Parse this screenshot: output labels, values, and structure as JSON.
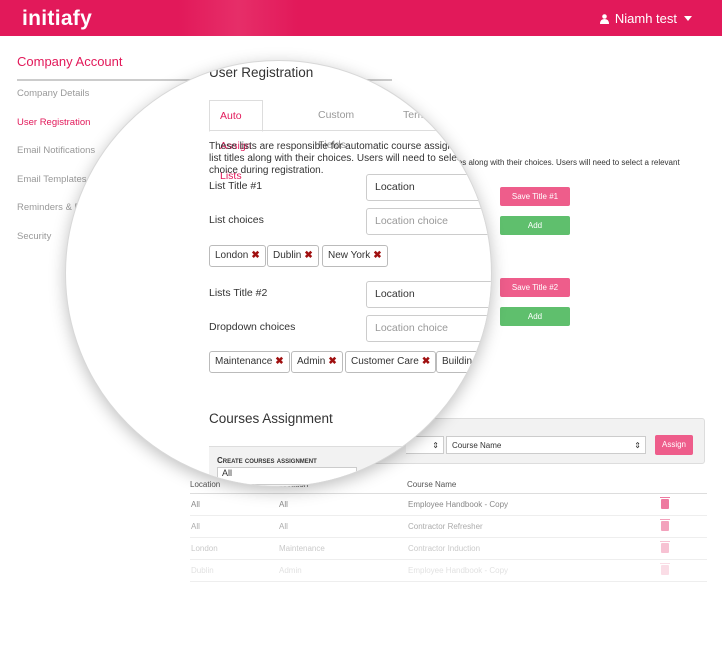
{
  "header": {
    "logo": "initiafy",
    "user": "Niamh test"
  },
  "sidebar": {
    "title": "Company Account",
    "items": [
      {
        "label": "Company Details",
        "active": false
      },
      {
        "label": "User Registration",
        "active": true
      },
      {
        "label": "Email Notifications",
        "active": false
      },
      {
        "label": "Email Templates",
        "active": false
      },
      {
        "label": "Reminders & Refreshers",
        "active": false
      },
      {
        "label": "Security",
        "active": false
      }
    ]
  },
  "page": {
    "title": "User Registration",
    "tabs": [
      "Auto Assign Lists",
      "Custom Fields",
      "Terms"
    ],
    "description": "These lists are responsible for automatic course assignment. Add your list titles along with their choices. Users will need to select a relevant choice during registration.",
    "description_tail": "itles along with their choices. Users will need to select a relevant"
  },
  "list1": {
    "title_label": "List Title #1",
    "title_value": "Location",
    "choices_label": "List choices",
    "choices_placeholder": "Location choice",
    "save_label": "Save Title #1",
    "add_label": "Add",
    "tags": [
      "London",
      "Dublin",
      "New York"
    ]
  },
  "list2": {
    "title_label": "Lists Title #2",
    "title_value": "Location",
    "choices_label": "Dropdown choices",
    "choices_placeholder": "Location choice",
    "save_label": "Save Title #2",
    "add_label": "Add",
    "tags": [
      "Maintenance",
      "Admin",
      "Customer Care",
      "Buildin"
    ]
  },
  "courses": {
    "title": "Courses Assignment",
    "create_label": "Create courses assignment",
    "create_value": "All",
    "course_select": "Course Name",
    "assign_label": "Assign",
    "columns": [
      "Location",
      "Location",
      "Course Name"
    ],
    "rows": [
      {
        "location": "All",
        "sub": "All",
        "course": "Employee Handbook - Copy"
      },
      {
        "location": "All",
        "sub": "All",
        "course": "Contractor Refresher"
      },
      {
        "location": "London",
        "sub": "Maintenance",
        "course": "Contractor Induction"
      },
      {
        "location": "Dublin",
        "sub": "Admin",
        "course": "Employee Handbook - Copy"
      }
    ]
  },
  "colors": {
    "brand": "#e2195a",
    "button_pink": "#ee5d8b",
    "button_green": "#5fbf6d"
  },
  "icons": [
    "user-icon",
    "chevron-down-icon",
    "remove-x-icon",
    "trash-icon",
    "select-arrows-icon"
  ]
}
